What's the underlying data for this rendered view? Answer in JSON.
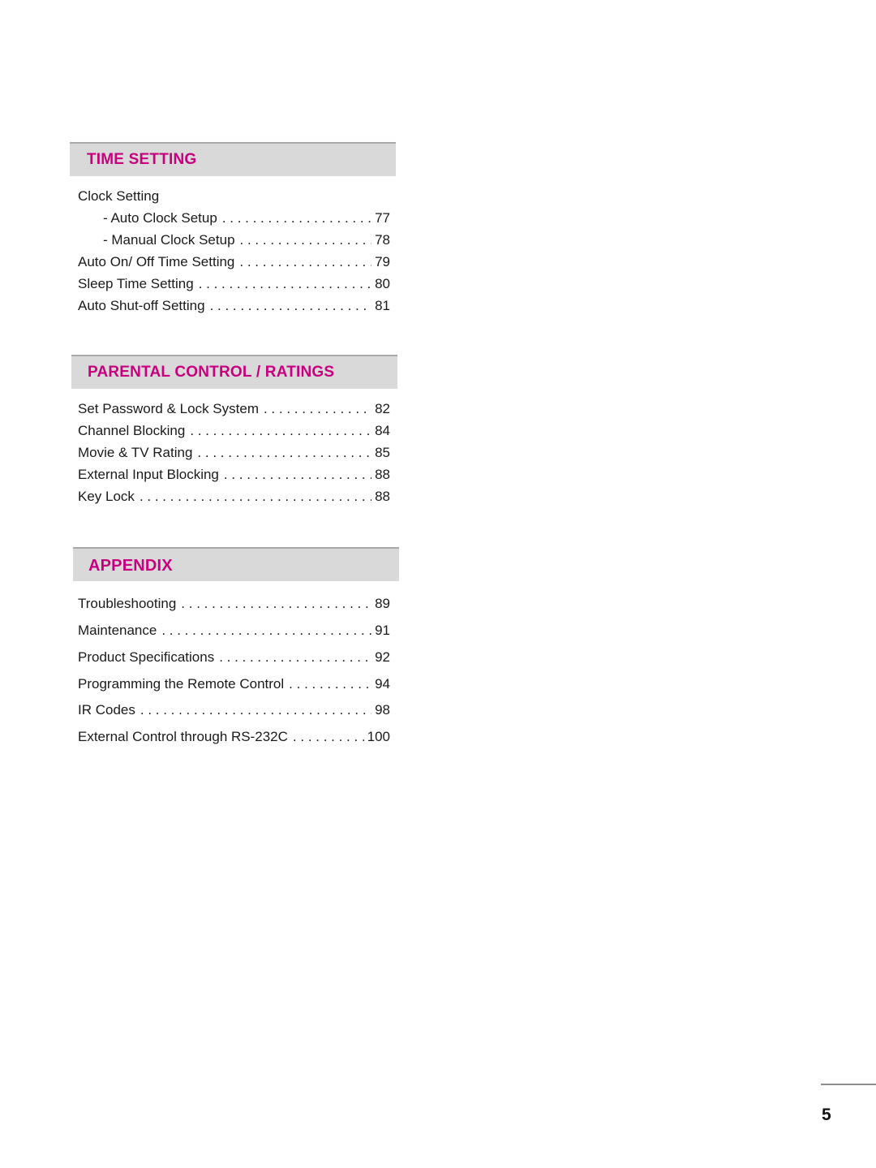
{
  "sections": [
    {
      "title": "TIME SETTING",
      "group_label": "Clock Setting",
      "entries": [
        {
          "label": "- Auto Clock Setup",
          "page": "77"
        },
        {
          "label": "- Manual Clock Setup",
          "page": "78"
        },
        {
          "label": "Auto On/ Off Time Setting",
          "page": "79"
        },
        {
          "label": "Sleep Time Setting",
          "page": "80"
        },
        {
          "label": "Auto Shut-off Setting",
          "page": "81"
        }
      ]
    },
    {
      "title": "PARENTAL CONTROL / RATINGS",
      "entries": [
        {
          "label": "Set Password & Lock System",
          "page": "82"
        },
        {
          "label": "Channel Blocking",
          "page": "84"
        },
        {
          "label": "Movie & TV Rating",
          "page": "85"
        },
        {
          "label": "External Input Blocking",
          "page": "88"
        },
        {
          "label": "Key Lock",
          "page": "88"
        }
      ]
    },
    {
      "title": "APPENDIX",
      "entries": [
        {
          "label": "Troubleshooting",
          "page": "89"
        },
        {
          "label": "Maintenance",
          "page": "91"
        },
        {
          "label": "Product Specifications",
          "page": "92"
        },
        {
          "label": "Programming the Remote Control",
          "page": "94"
        },
        {
          "label": "IR Codes",
          "page": "98"
        },
        {
          "label": "External Control through RS-232C",
          "page": "100"
        }
      ]
    }
  ],
  "footer": {
    "page_number": "5"
  },
  "colors": {
    "heading": "#c8007e",
    "header_bg": "#d9d9d9"
  }
}
